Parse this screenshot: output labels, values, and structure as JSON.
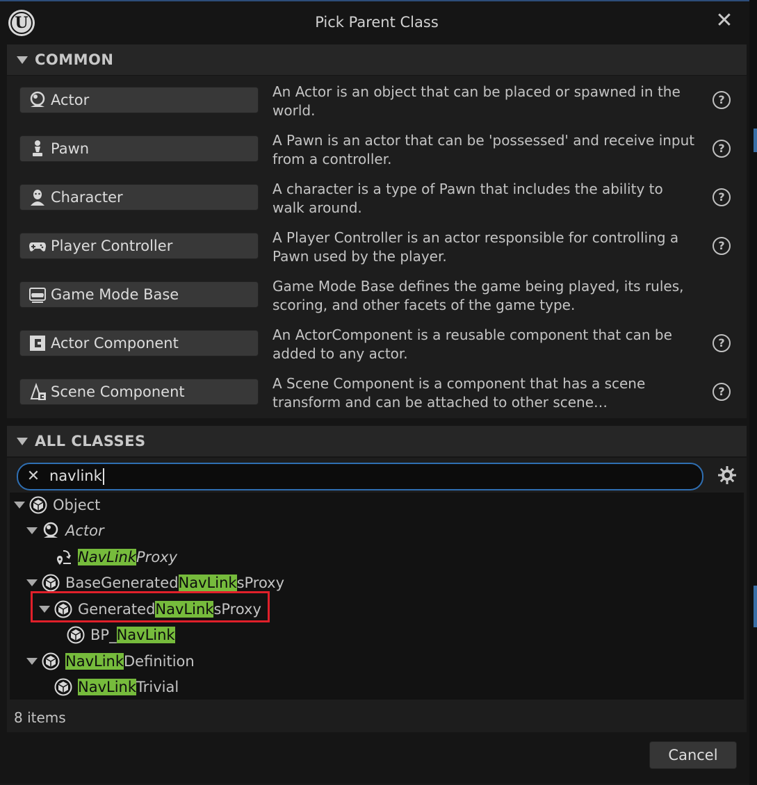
{
  "window": {
    "title": "Pick Parent Class"
  },
  "common": {
    "header": "COMMON",
    "items": [
      {
        "label": "Actor",
        "icon": "actor-icon",
        "description": "An Actor is an object that can be placed or spawned in the world.",
        "help": "?"
      },
      {
        "label": "Pawn",
        "icon": "pawn-icon",
        "description": "A Pawn is an actor that can be 'possessed' and receive input from a controller.",
        "help": "?"
      },
      {
        "label": "Character",
        "icon": "character-icon",
        "description": "A character is a type of Pawn that includes the ability to walk around.",
        "help": "?"
      },
      {
        "label": "Player Controller",
        "icon": "gamepad-icon",
        "description": "A Player Controller is an actor responsible for controlling a Pawn used by the player.",
        "help": "?"
      },
      {
        "label": "Game Mode Base",
        "icon": "game-mode-icon",
        "description": "Game Mode Base defines the game being played, its rules, scoring, and other facets of the game type.",
        "help": ""
      },
      {
        "label": "Actor Component",
        "icon": "actor-component-icon",
        "description": "An ActorComponent is a reusable component that can be added to any actor.",
        "help": "?"
      },
      {
        "label": "Scene Component",
        "icon": "scene-component-icon",
        "description": "A Scene Component is a component that has a scene transform and can be attached to other scene…",
        "help": "?"
      }
    ]
  },
  "all_classes": {
    "header": "ALL CLASSES",
    "search_value": "navlink",
    "tree": [
      {
        "pre": "Object",
        "match": "",
        "post": "",
        "icon": "class-icon"
      },
      {
        "pre": "Actor",
        "match": "",
        "post": "",
        "icon": "actor-icon"
      },
      {
        "pre": "",
        "match": "NavLink",
        "post": "Proxy",
        "icon": "navlink-proxy-icon"
      },
      {
        "pre": "BaseGenerated",
        "match": "NavLink",
        "post": "sProxy",
        "icon": "class-icon"
      },
      {
        "pre": "Generated",
        "match": "NavLink",
        "post": "sProxy",
        "icon": "class-icon"
      },
      {
        "pre": "BP_",
        "match": "NavLink",
        "post": "",
        "icon": "class-icon"
      },
      {
        "pre": "",
        "match": "NavLink",
        "post": "Definition",
        "icon": "class-icon"
      },
      {
        "pre": "",
        "match": "NavLink",
        "post": "Trivial",
        "icon": "class-icon"
      }
    ],
    "item_count": "8 items"
  },
  "footer": {
    "cancel_label": "Cancel"
  },
  "colors": {
    "highlight": "#76bb3c",
    "focus_border": "#2f6fb3",
    "annotation_box": "#e0202a"
  }
}
